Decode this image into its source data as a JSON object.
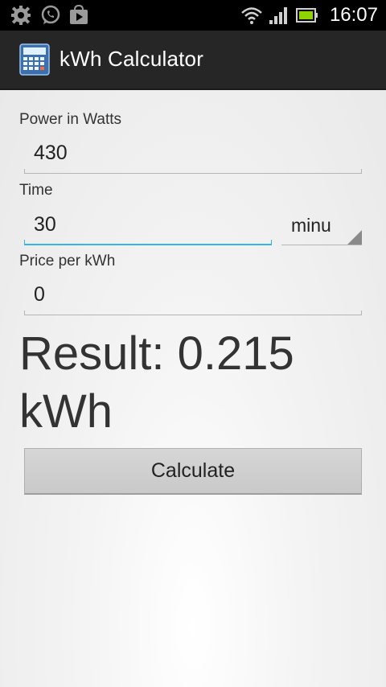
{
  "status_bar": {
    "time": "16:07",
    "icons": [
      "settings-gear-icon",
      "whatsapp-icon",
      "play-store-icon",
      "wifi-icon",
      "signal-icon",
      "battery-icon"
    ]
  },
  "app": {
    "title": "kWh Calculator",
    "icon": "calculator-icon"
  },
  "form": {
    "power": {
      "label": "Power in Watts",
      "value": "430"
    },
    "time": {
      "label": "Time",
      "value": "30",
      "unit_selected": "minu"
    },
    "price": {
      "label": "Price per kWh",
      "value": "0"
    }
  },
  "result": {
    "text": "Result: 0.215 kWh"
  },
  "calculate_button": {
    "label": "Calculate"
  },
  "colors": {
    "focus_underline": "#33b5e5",
    "action_bar": "#262626",
    "status_bar": "#000000"
  }
}
